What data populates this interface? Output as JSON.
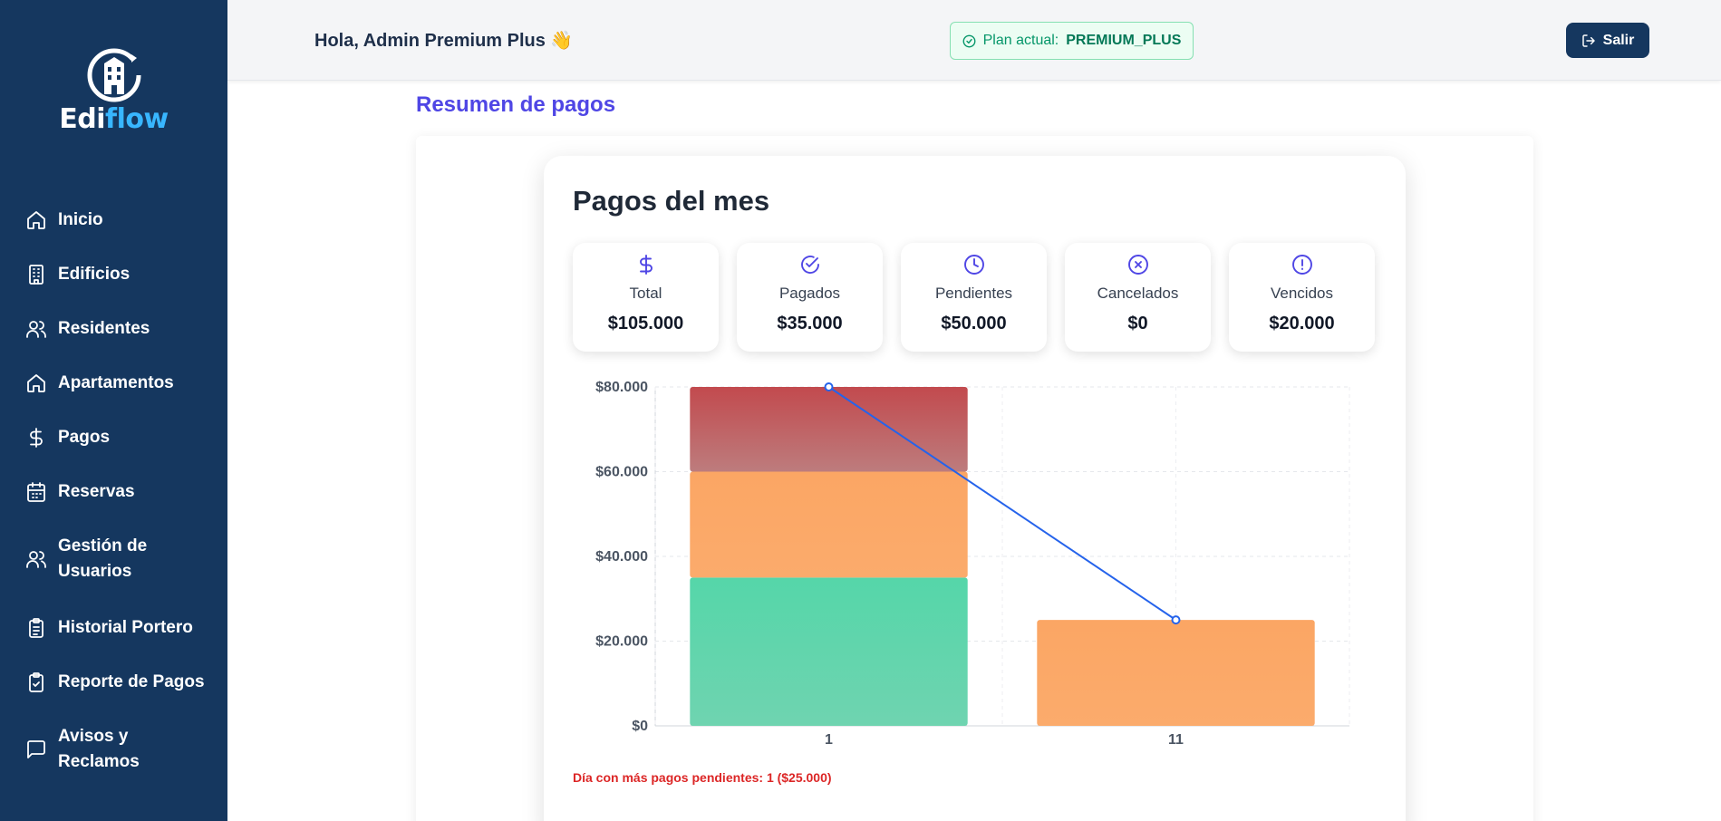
{
  "app": {
    "logo_primary": "Edi",
    "logo_accent": "flow"
  },
  "sidebar": {
    "items": [
      {
        "label": "Inicio",
        "icon": "home-icon"
      },
      {
        "label": "Edificios",
        "icon": "building-icon"
      },
      {
        "label": "Residentes",
        "icon": "users-icon"
      },
      {
        "label": "Apartamentos",
        "icon": "home-icon"
      },
      {
        "label": "Pagos",
        "icon": "dollar-icon"
      },
      {
        "label": "Reservas",
        "icon": "calendar-icon"
      },
      {
        "label": "Gestión de Usuarios",
        "icon": "users-icon"
      },
      {
        "label": "Historial Portero",
        "icon": "clipboard-icon"
      },
      {
        "label": "Reporte de Pagos",
        "icon": "clipboard-check-icon"
      },
      {
        "label": "Avisos y Reclamos",
        "icon": "message-icon"
      }
    ]
  },
  "header": {
    "greeting": "Hola, Admin Premium Plus 👋",
    "plan_label": "Plan actual:",
    "plan_value": "PREMIUM_PLUS",
    "logout_label": "Salir"
  },
  "main": {
    "section_title": "Resumen de pagos",
    "card_title": "Pagos del mes",
    "stats": [
      {
        "label": "Total",
        "value": "$105.000",
        "icon": "dollar-icon"
      },
      {
        "label": "Pagados",
        "value": "$35.000",
        "icon": "check-circle-icon"
      },
      {
        "label": "Pendientes",
        "value": "$50.000",
        "icon": "clock-icon"
      },
      {
        "label": "Cancelados",
        "value": "$0",
        "icon": "x-circle-icon"
      },
      {
        "label": "Vencidos",
        "value": "$20.000",
        "icon": "alert-circle-icon"
      }
    ],
    "footnote": "Día con más pagos pendientes: 1 ($25.000)"
  },
  "colors": {
    "sidebar_bg": "#15375f",
    "accent": "#4f46e5",
    "paid": "#5dd6a9",
    "pending": "#fba765",
    "overdue": "#c24f52",
    "line": "#2563eb"
  },
  "chart_data": {
    "type": "bar",
    "stacked": true,
    "categories": [
      "1",
      "11"
    ],
    "series": [
      {
        "values": [
          35000,
          0
        ],
        "color": "#5dd6a9"
      },
      {
        "values": [
          25000,
          25000
        ],
        "color": "#fba765"
      },
      {
        "values": [
          20000,
          0
        ],
        "color": "#c24f52"
      }
    ],
    "line_series": {
      "values": [
        80000,
        25000
      ],
      "color": "#2563eb"
    },
    "ylim": [
      0,
      80000
    ],
    "yticks": [
      {
        "value": 0,
        "label": "$0"
      },
      {
        "value": 20000,
        "label": "$20.000"
      },
      {
        "value": 40000,
        "label": "$40.000"
      },
      {
        "value": 60000,
        "label": "$60.000"
      },
      {
        "value": 80000,
        "label": "$80.000"
      }
    ],
    "grid": true
  }
}
